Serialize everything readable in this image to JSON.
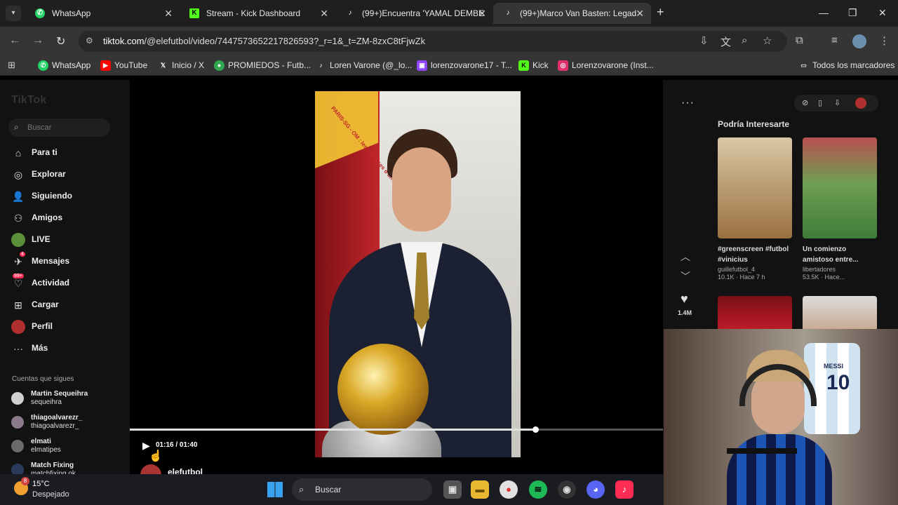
{
  "tabs": [
    {
      "label": "WhatsApp",
      "icon": "whatsapp-icon",
      "color": "#25d366"
    },
    {
      "label": "Stream - Kick Dashboard",
      "icon": "kick-icon",
      "color": "#53fc18"
    },
    {
      "label": "(99+)Encuentra 'YAMAL DEMBE",
      "icon": "tiktok-icon",
      "color": "#ffffff"
    },
    {
      "label": "(99+)Marco Van Basten: Legad",
      "icon": "tiktok-icon",
      "color": "#ffffff"
    }
  ],
  "address": {
    "domain": "tiktok.com",
    "path": "/@elefutbol/video/7447573652217826593?_r=1&_t=ZM-8zxC8tFjwZk"
  },
  "bookmarks": [
    {
      "label": "WhatsApp",
      "icon": "whatsapp-icon",
      "color": "#25d366"
    },
    {
      "label": "YouTube",
      "icon": "youtube-icon",
      "color": "#ff0000"
    },
    {
      "label": "Inicio / X",
      "icon": "x-icon",
      "color": "#ffffff"
    },
    {
      "label": "PROMIEDOS - Futb...",
      "icon": "promiedos-icon",
      "color": "#2fa84f"
    },
    {
      "label": "Loren Varone (@_lo...",
      "icon": "tiktok-icon",
      "color": "#ffffff"
    },
    {
      "label": "lorenzovarone17 - T...",
      "icon": "twitch-icon",
      "color": "#9146ff"
    },
    {
      "label": "Kick",
      "icon": "kick-icon",
      "color": "#53fc18"
    },
    {
      "label": "Lorenzovarone (Inst...",
      "icon": "instagram-icon",
      "color": "#e1306c"
    }
  ],
  "all_bookmarks": "Todos los marcadores",
  "tiktok": {
    "logo": "TikTok",
    "search_placeholder": "Buscar",
    "nav": [
      {
        "label": "Para ti",
        "icon": "home-icon"
      },
      {
        "label": "Explorar",
        "icon": "compass-icon"
      },
      {
        "label": "Siguiendo",
        "icon": "following-icon"
      },
      {
        "label": "Amigos",
        "icon": "friends-icon"
      },
      {
        "label": "LIVE",
        "icon": "live-icon"
      },
      {
        "label": "Mensajes",
        "icon": "messages-icon",
        "badge": "4"
      },
      {
        "label": "Actividad",
        "icon": "activity-icon",
        "badge": "99+"
      },
      {
        "label": "Cargar",
        "icon": "upload-icon"
      },
      {
        "label": "Perfil",
        "icon": "profile-icon"
      },
      {
        "label": "Más",
        "icon": "more-icon"
      }
    ],
    "following_title": "Cuentas que sigues",
    "following": [
      {
        "name": "Martin Sequeihra",
        "handle": "sequeihra"
      },
      {
        "name": "thiagoalvarezr_",
        "handle": "thiagoalvarezr_"
      },
      {
        "name": "elmati",
        "handle": "elmatipes"
      },
      {
        "name": "Match Fixing",
        "handle": "matchfixing.ok"
      }
    ],
    "player": {
      "time": "01:16 / 01:40",
      "progress": 0.76,
      "author": "elefutbol",
      "poster_text": "PARIS-SG - OM : les coulisses d'un sommet",
      "likes": "1.4M"
    },
    "suggestions_title": "Podría Interesarte",
    "suggestions": [
      {
        "title": "#greenscreen #futbol #vinicius",
        "user": "guillefutbol_4",
        "meta": "10.1K · Hace 7 h",
        "color": "#b98a55"
      },
      {
        "title": "Un comienzo amistoso entre...",
        "user": "libertadores",
        "meta": "53.5K · Hace...",
        "color": "#3f7c3a"
      }
    ]
  },
  "webcam": {
    "jersey_name": "MESSI",
    "jersey_number": "10"
  },
  "taskbar": {
    "temperature": "15°C",
    "condition": "Despejado",
    "weather_badge": "8",
    "search_label": "Buscar"
  }
}
